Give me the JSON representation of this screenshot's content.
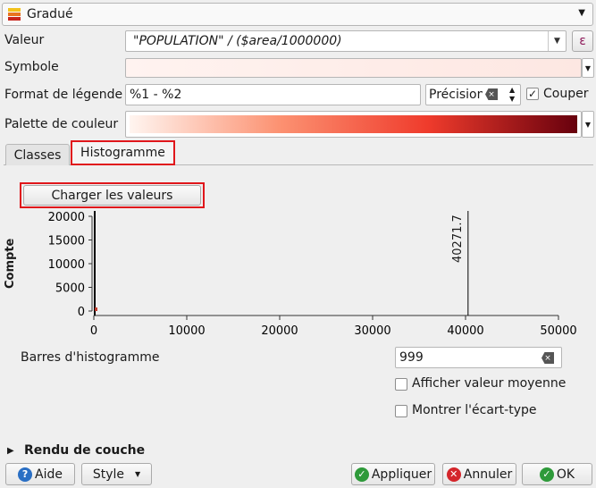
{
  "renderer": {
    "label": "Gradué",
    "icon": "graduated-renderer-icon"
  },
  "value": {
    "label": "Valeur",
    "expression": "\"POPULATION\"  / ($area/1000000)",
    "expr_button": "ε"
  },
  "symbol": {
    "label": "Symbole"
  },
  "legend_format": {
    "label": "Format de légende",
    "value": "%1 - %2",
    "precision_placeholder": "Précision",
    "cut_label": "Couper",
    "cut_checked": true
  },
  "color_ramp": {
    "label": "Palette de couleur",
    "colors": [
      "#fff5f0",
      "#fc9272",
      "#ef3b2c",
      "#67000d"
    ]
  },
  "tabs": {
    "classes": "Classes",
    "histogram": "Histogramme"
  },
  "load_values_button": "Charger les valeurs",
  "histogram": {
    "ylabel": "Compte",
    "y_ticks": [
      "20000",
      "15000",
      "10000",
      "5000",
      "0"
    ],
    "x_ticks": [
      "0",
      "10000",
      "20000",
      "30000",
      "40000",
      "50000"
    ],
    "marker_label": "40271.7"
  },
  "chart_data": {
    "type": "bar",
    "ylabel": "Compte",
    "xlim": [
      0,
      50000
    ],
    "ylim": [
      0,
      20000
    ],
    "annotations": [
      "40271.7"
    ]
  },
  "bins": {
    "label": "Barres d'histogramme",
    "value": "999"
  },
  "options": {
    "show_mean": "Afficher valeur moyenne",
    "show_std": "Montrer l'écart-type"
  },
  "layer_rendering": {
    "label": "Rendu de couche"
  },
  "footer": {
    "help": "Aide",
    "style": "Style",
    "apply": "Appliquer",
    "cancel": "Annuler",
    "ok": "OK"
  }
}
